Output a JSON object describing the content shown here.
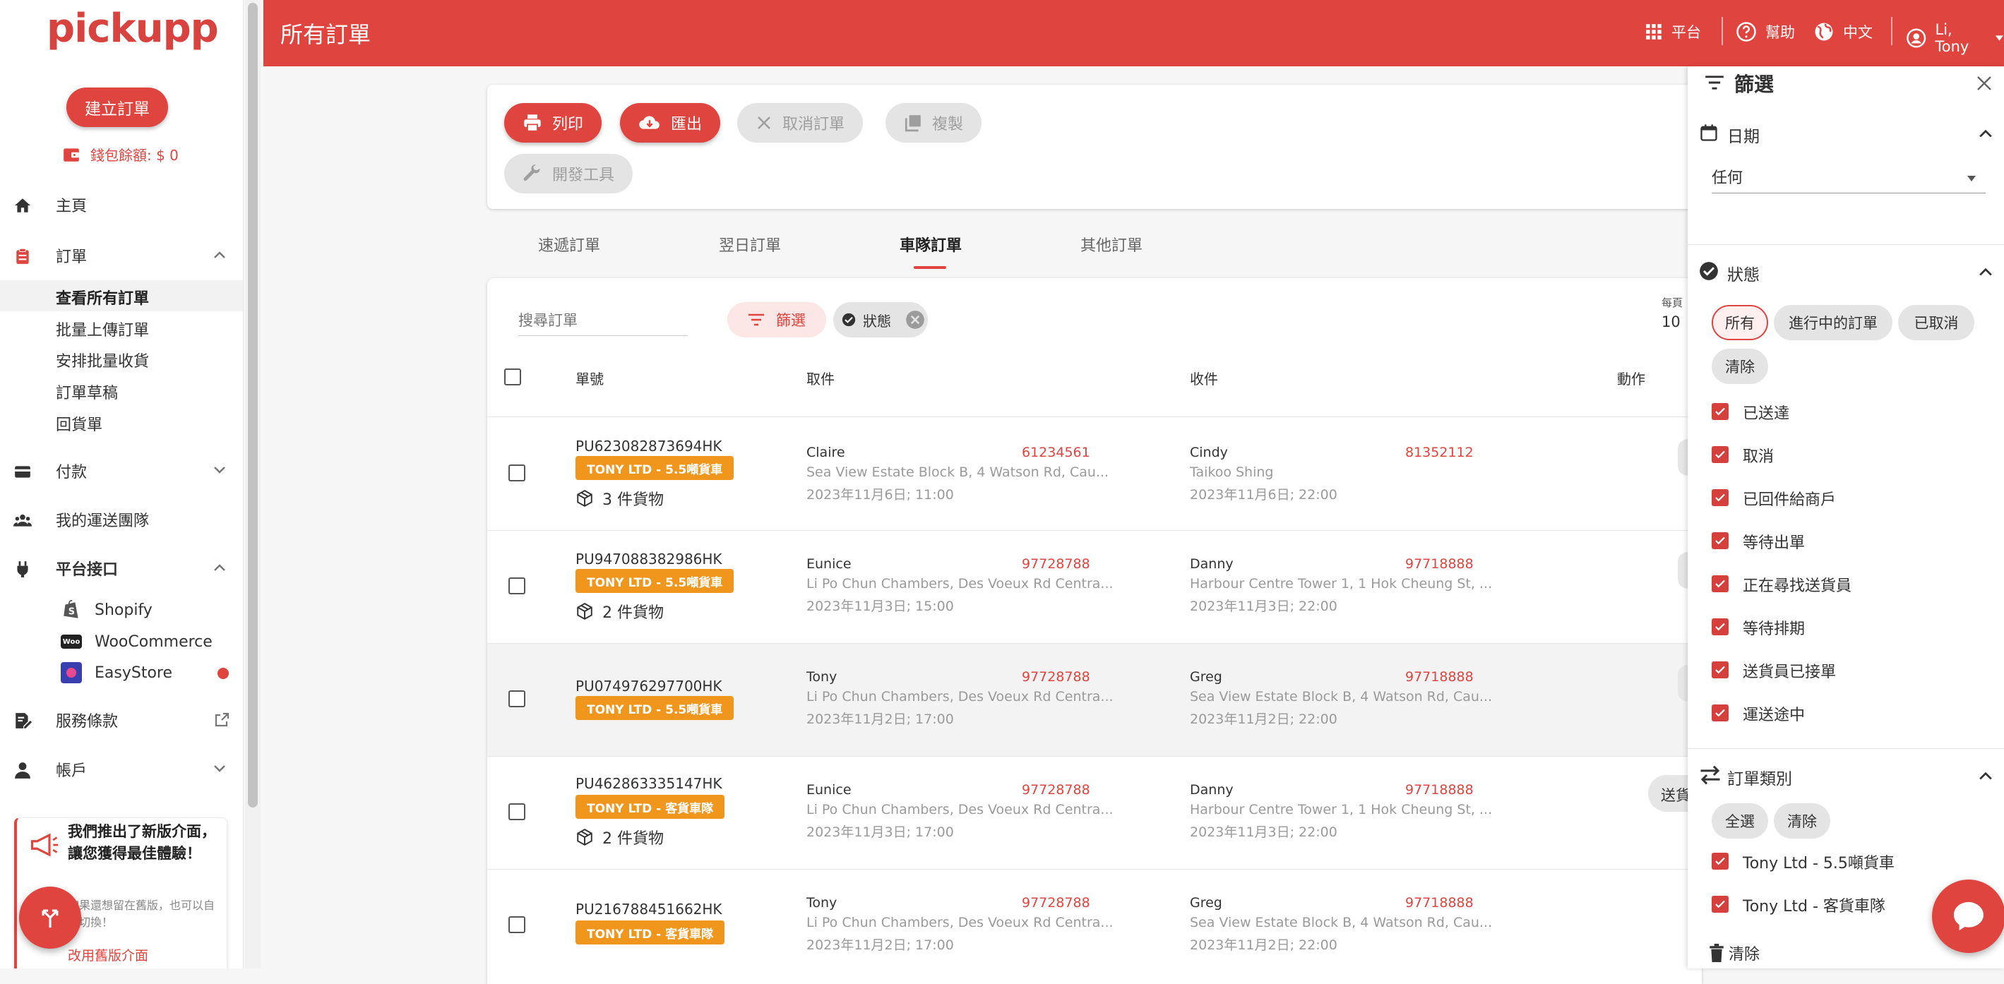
{
  "brand": {
    "logo_text": "pickupp",
    "accent": "#e0443f"
  },
  "sidebar": {
    "create_label": "建立訂單",
    "wallet_label": "錢包餘額: $ 0",
    "home": "主頁",
    "orders": "訂單",
    "order_sub": [
      "查看所有訂單",
      "批量上傳訂單",
      "安排批量收貨",
      "訂單草稿",
      "回貨單"
    ],
    "payment": "付款",
    "team": "我的運送團隊",
    "platform": "平台接口",
    "platforms": [
      "Shopify",
      "WooCommerce",
      "EasyStore"
    ],
    "terms": "服務條款",
    "account": "帳戶",
    "promo_title": "我們推出了新版介面，讓您獲得最佳體驗！",
    "promo_body": "如果還想留在舊版，也可以自由切換！",
    "promo_link": "改用舊版介面"
  },
  "header": {
    "title": "所有訂單",
    "platform": "平台",
    "help": "幫助",
    "language": "中文",
    "user": "Li, Tony"
  },
  "toolbar": {
    "print": "列印",
    "export": "匯出",
    "cancel": "取消訂單",
    "copy": "複製",
    "dev": "開發工具"
  },
  "tabs": [
    "速遞訂單",
    "翌日訂單",
    "車隊訂單",
    "其他訂單"
  ],
  "list": {
    "search_placeholder": "搜尋訂單",
    "filter": "篩選",
    "status_chip": "狀態",
    "per_page_label": "每頁",
    "per_page_value": "10",
    "headers": {
      "id": "單號",
      "pickup": "取件",
      "dropoff": "收件",
      "action": "動作"
    }
  },
  "orders": [
    {
      "id": "PU623082873694HK",
      "badge": "TONY LTD - 5.5噸貨車",
      "items": "3 件貨物",
      "p_name": "Claire",
      "p_phone": "61234561",
      "p_addr": "Sea View Estate Block B, 4 Watson Rd, Cau...",
      "p_time": "2023年11月6日; 11:00",
      "d_name": "Cindy",
      "d_phone": "81352112",
      "d_addr": "Taikoo Shing",
      "d_time": "2023年11月6日; 22:00",
      "action": ""
    },
    {
      "id": "PU947088382986HK",
      "badge": "TONY LTD - 5.5噸貨車",
      "items": "2 件貨物",
      "p_name": "Eunice",
      "p_phone": "97728788",
      "p_addr": "Li Po Chun Chambers, Des Voeux Rd Centra...",
      "p_time": "2023年11月3日; 15:00",
      "d_name": "Danny",
      "d_phone": "97718888",
      "d_addr": "Harbour Centre Tower 1, 1 Hok Cheung St, ...",
      "d_time": "2023年11月3日; 22:00",
      "action": ""
    },
    {
      "id": "PU074976297700HK",
      "badge": "TONY LTD - 5.5噸貨車",
      "items": "",
      "p_name": "Tony",
      "p_phone": "97728788",
      "p_addr": "Li Po Chun Chambers, Des Voeux Rd Centra...",
      "p_time": "2023年11月2日; 17:00",
      "d_name": "Greg",
      "d_phone": "97718888",
      "d_addr": "Sea View Estate Block B, 4 Watson Rd, Cau...",
      "d_time": "2023年11月2日; 22:00",
      "action": ""
    },
    {
      "id": "PU462863335147HK",
      "badge": "TONY LTD - 客貨車隊",
      "items": "2 件貨物",
      "p_name": "Eunice",
      "p_phone": "97728788",
      "p_addr": "Li Po Chun Chambers, Des Voeux Rd Centra...",
      "p_time": "2023年11月3日; 17:00",
      "d_name": "Danny",
      "d_phone": "97718888",
      "d_addr": "Harbour Centre Tower 1, 1 Hok Cheung St, ...",
      "d_time": "2023年11月3日; 22:00",
      "action": "送貨"
    },
    {
      "id": "PU216788451662HK",
      "badge": "TONY LTD - 客貨車隊",
      "items": "",
      "p_name": "Tony",
      "p_phone": "97728788",
      "p_addr": "Li Po Chun Chambers, Des Voeux Rd Centra...",
      "p_time": "2023年11月2日; 17:00",
      "d_name": "Greg",
      "d_phone": "97718888",
      "d_addr": "Sea View Estate Block B, 4 Watson Rd, Cau...",
      "d_time": "2023年11月2日; 22:00",
      "action": ""
    }
  ],
  "filter": {
    "title": "篩選",
    "date_title": "日期",
    "date_value": "任何",
    "status_title": "狀態",
    "status_chips": [
      "所有",
      "進行中的訂單",
      "已取消",
      "清除"
    ],
    "statuses": [
      "已送達",
      "取消",
      "已回件給商戶",
      "等待出單",
      "正在尋找送貨員",
      "等待排期",
      "送貨員已接單",
      "運送途中"
    ],
    "type_title": "訂單類別",
    "type_chips": [
      "全選",
      "清除"
    ],
    "types": [
      "Tony Ltd - 5.5噸貨車",
      "Tony Ltd - 客貨車隊"
    ],
    "clear": "清除"
  }
}
